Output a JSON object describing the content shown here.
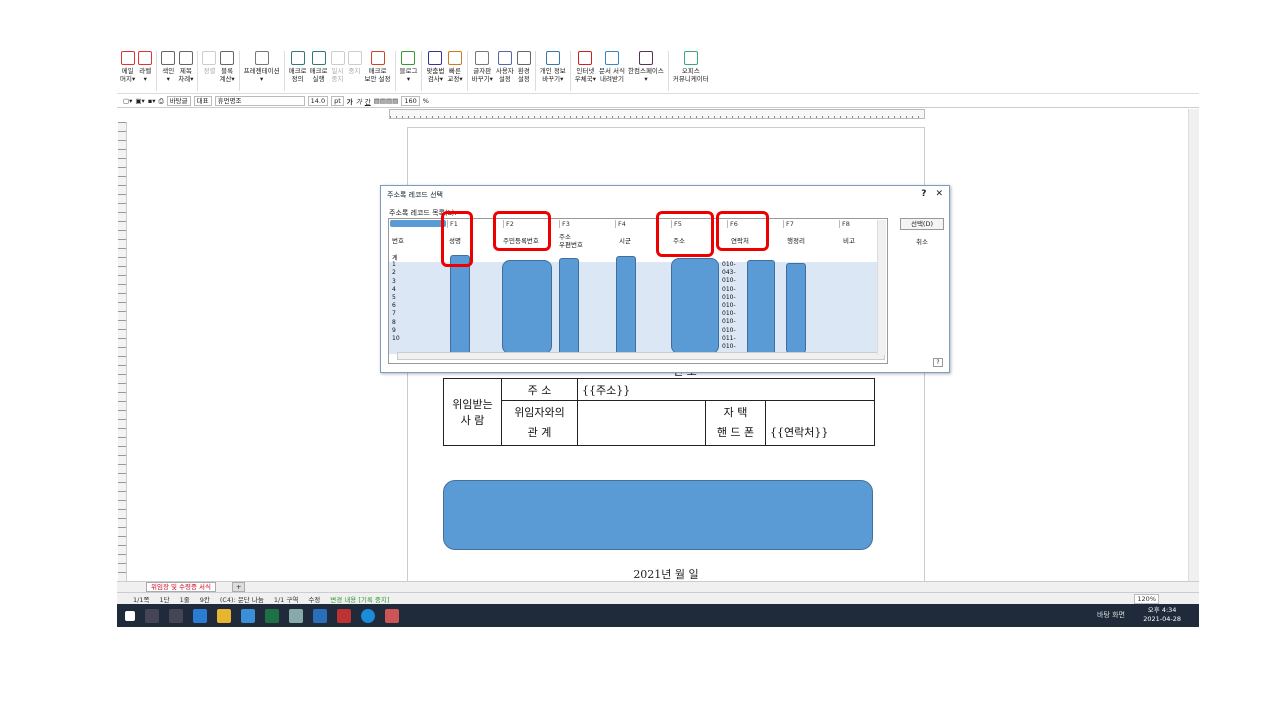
{
  "ribbon": {
    "items": [
      {
        "label": "메일\n머지▾",
        "c": "#d33"
      },
      {
        "label": "라벨\n▾",
        "c": "#d33"
      },
      {
        "label": "색인\n▾",
        "c": "#666"
      },
      {
        "label": "제목\n차례▾",
        "c": "#666"
      },
      {
        "label": "정렬",
        "c": "#ccc",
        "dis": true
      },
      {
        "label": "블록\n계산▾",
        "c": "#666"
      },
      {
        "label": "프레젠테이션\n▾",
        "c": "#777"
      },
      {
        "label": "매크로\n정의",
        "c": "#377"
      },
      {
        "label": "매크로\n실행",
        "c": "#377"
      },
      {
        "label": "일시\n중지",
        "c": "#ccc",
        "dis": true
      },
      {
        "label": "중지",
        "c": "#ccc",
        "dis": true
      },
      {
        "label": "매크로\n보안 설정",
        "c": "#c42"
      },
      {
        "label": "블로그\n▾",
        "c": "#393"
      },
      {
        "label": "맞춤법\n검사▾",
        "c": "#339"
      },
      {
        "label": "빠른\n교정▾",
        "c": "#c72"
      },
      {
        "label": "글자판\n바꾸기▾",
        "c": "#777"
      },
      {
        "label": "사용자\n설정",
        "c": "#56a"
      },
      {
        "label": "환경\n설정",
        "c": "#666"
      },
      {
        "label": "개인 정보\n바꾸기▾",
        "c": "#37a"
      },
      {
        "label": "인터넷\n우체국▾",
        "c": "#c22"
      },
      {
        "label": "문서 서식\n내려받기",
        "c": "#38c"
      },
      {
        "label": "한컴스페이스\n▾",
        "c": "#535"
      },
      {
        "label": "오피스\n커뮤니케이터",
        "c": "#3a7"
      }
    ]
  },
  "format": {
    "style": "바탕글",
    "para": "대표",
    "font": "휴먼명조",
    "size": "14.0",
    "unit": "pt",
    "zoom": "160",
    "zunit": "%"
  },
  "dialog": {
    "title": "주소록 레코드 선택",
    "help": "?",
    "close": "✕",
    "list_label": "주소록 레코드 목록(L):",
    "select_button": "선택(D)",
    "cancel_button": "취소",
    "fields": [
      "F1",
      "F2",
      "F3",
      "F4",
      "F5",
      "F6",
      "F7",
      "F8"
    ],
    "columns": [
      "번호",
      "성명",
      "주민등록번호",
      "주소\n우편번호",
      "시군",
      "주소",
      "연락처",
      "행정리",
      "비고"
    ],
    "rows": [
      "계",
      "1",
      "2",
      "3",
      "4",
      "5",
      "6",
      "7",
      "8",
      "9",
      "10"
    ],
    "phones": [
      "010-",
      "043-",
      "010-",
      "010-",
      "010-",
      "010-",
      "010-",
      "010-",
      "010-",
      "011-",
      "010-"
    ]
  },
  "doc": {
    "label_grantee": "위임받는\n사 람",
    "row_addr_label": "주 소",
    "row_addr_value": "{{주소}}",
    "row_rel_label": "위임자와의\n관 계",
    "home_label": "자 택",
    "mobile_label": "핸 드 폰",
    "mobile_value": "{{연락처}}",
    "top_partial": "번 호",
    "date": "2021년 월 일"
  },
  "sheet": {
    "tab": "위임장 및 수령증 서식"
  },
  "status": {
    "items": [
      "1/1쪽",
      "1단",
      "1줄",
      "9칸",
      "(C4): 문단 나눔",
      "1/1 구역",
      "수정",
      "변경 내용 [기록 중지]"
    ],
    "zoom": "120%"
  },
  "taskbar": {
    "tray": "바탕 화면",
    "time": "오후 4:34",
    "date": "2021-04-28"
  }
}
